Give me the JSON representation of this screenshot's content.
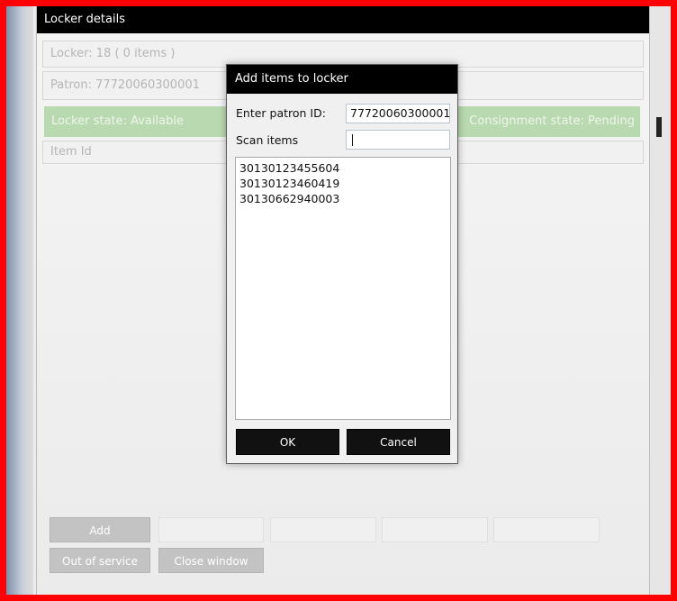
{
  "main_window": {
    "title": "Locker details",
    "locker_line": "Locker: 18 ( 0 items )",
    "patron_line": "Patron:  77720060300001",
    "locker_state": "Locker state: Available",
    "consignment_state": "Consignment state: Pending",
    "item_column_header": "Item Id",
    "buttons": {
      "add": "Add",
      "out_of_service": "Out of service",
      "close_window": "Close window"
    }
  },
  "dialog": {
    "title": "Add items to locker",
    "patron_label": "Enter patron ID:",
    "patron_value": "77720060300001",
    "scan_label": "Scan items",
    "scan_value": "",
    "items": [
      "30130123455604",
      "30130123460419",
      "30130662940003"
    ],
    "ok_label": "OK",
    "cancel_label": "Cancel"
  },
  "colors": {
    "frame_border": "#ff0000",
    "title_bar": "#000000",
    "state_bar": "#b9d9b0",
    "button_grey": "#c3c3c3"
  }
}
